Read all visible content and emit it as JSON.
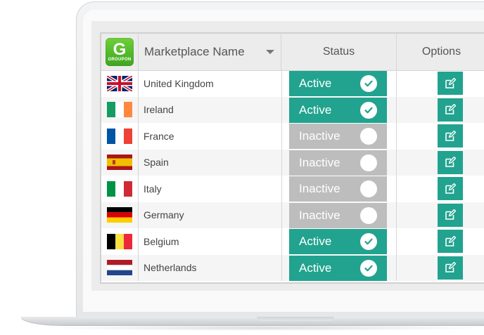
{
  "header": {
    "logo_g": "G",
    "logo_text": "GROUPON",
    "col_name": "Marketplace Name",
    "col_status": "Status",
    "col_options": "Options"
  },
  "colors": {
    "active": "#21a38f",
    "inactive": "#bdbdbd",
    "logo": "#4cb52a"
  },
  "rows": [
    {
      "name": "United Kingdom",
      "flag": "uk-flag-icon",
      "status": "Active"
    },
    {
      "name": "Ireland",
      "flag": "ireland-flag-icon",
      "status": "Active"
    },
    {
      "name": "France",
      "flag": "france-flag-icon",
      "status": "Inactive"
    },
    {
      "name": "Spain",
      "flag": "spain-flag-icon",
      "status": "Inactive"
    },
    {
      "name": "Italy",
      "flag": "italy-flag-icon",
      "status": "Inactive"
    },
    {
      "name": "Germany",
      "flag": "germany-flag-icon",
      "status": "Inactive"
    },
    {
      "name": "Belgium",
      "flag": "belgium-flag-icon",
      "status": "Active"
    },
    {
      "name": "Netherlands",
      "flag": "netherlands-flag-icon",
      "status": "Active"
    }
  ]
}
